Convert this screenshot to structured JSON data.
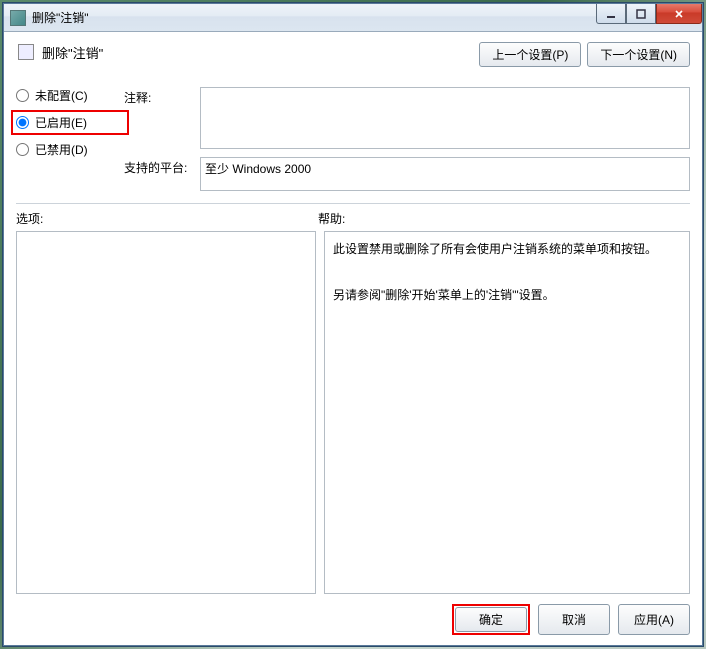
{
  "window": {
    "title": "删除\"注销\""
  },
  "header": {
    "policy_name": "删除\"注销\"",
    "prev_btn": "上一个设置(P)",
    "next_btn": "下一个设置(N)"
  },
  "radios": {
    "not_configured": "未配置(C)",
    "enabled": "已启用(E)",
    "disabled": "已禁用(D)"
  },
  "labels": {
    "comment": "注释:",
    "platform": "支持的平台:",
    "options": "选项:",
    "help": "帮助:"
  },
  "platform": {
    "value": "至少 Windows 2000"
  },
  "help": {
    "line1": "此设置禁用或删除了所有会使用户注销系统的菜单项和按钮。",
    "line2": "另请参阅\"删除'开始'菜单上的'注销'\"设置。"
  },
  "footer": {
    "ok": "确定",
    "cancel": "取消",
    "apply": "应用(A)"
  }
}
